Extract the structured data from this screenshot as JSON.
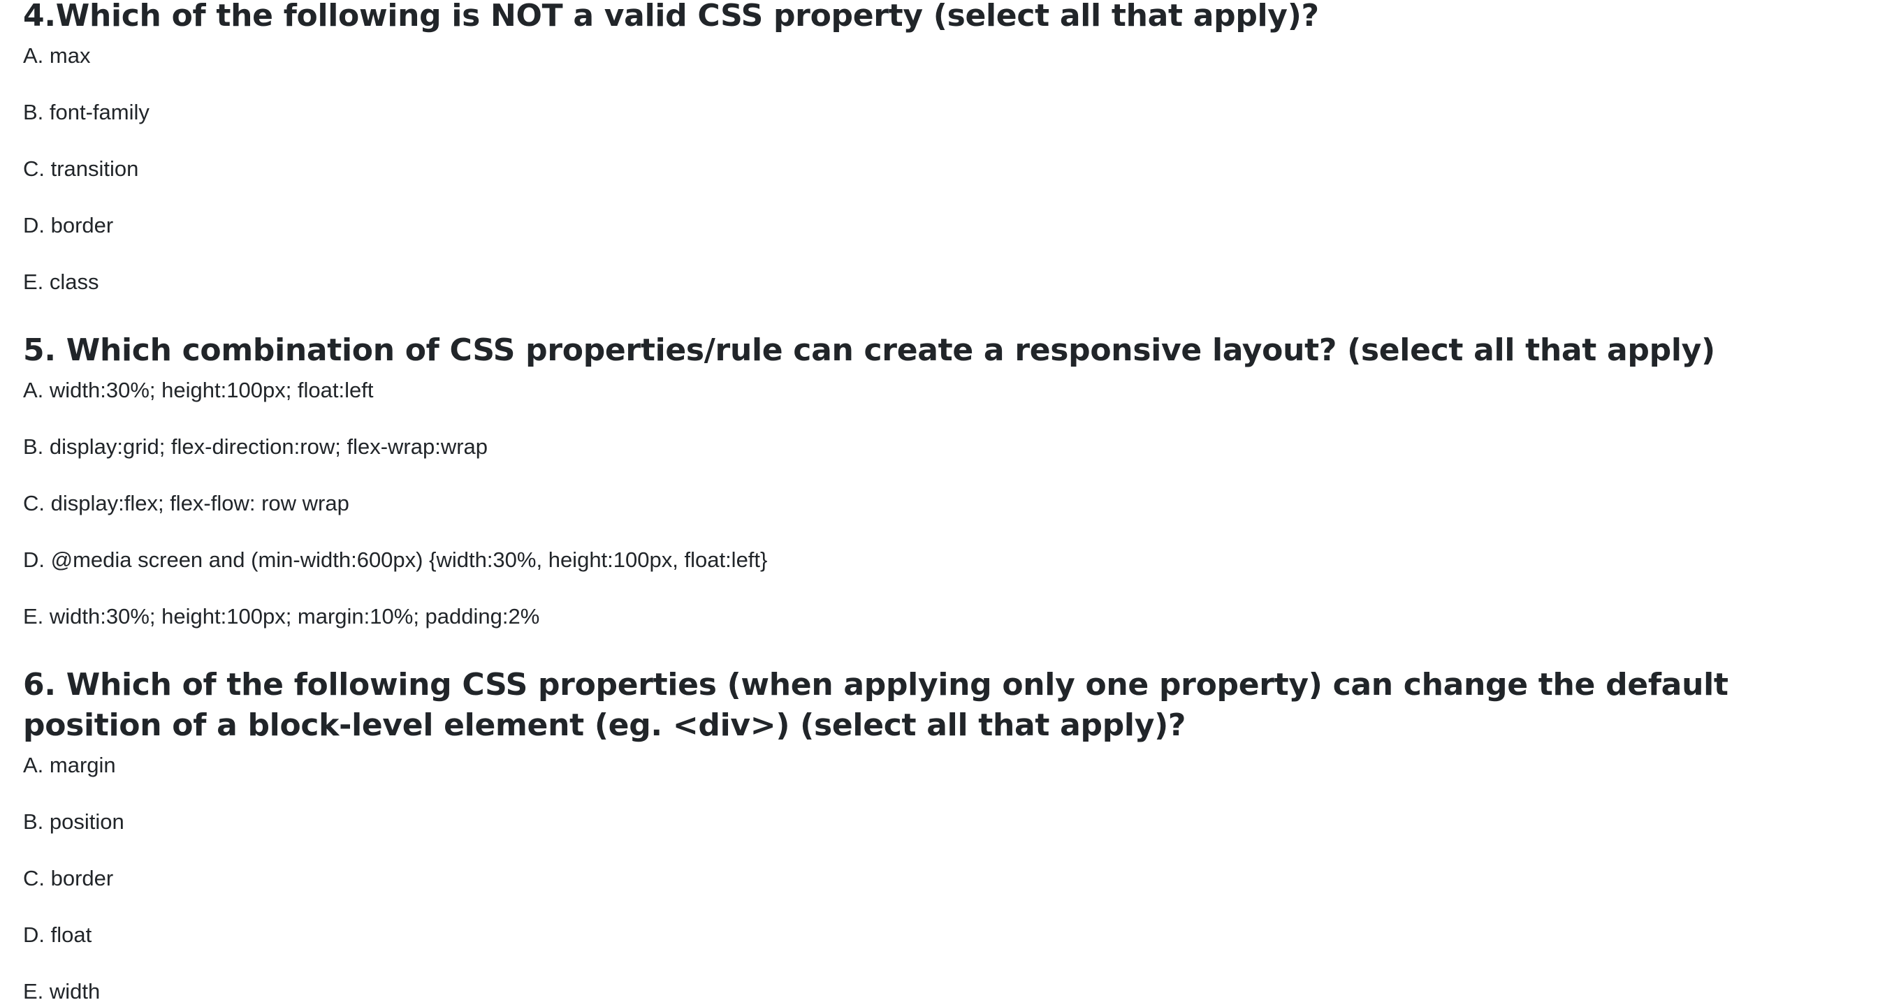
{
  "questions": [
    {
      "title": "4.Which of the following is NOT a valid CSS property (select all that apply)?",
      "options": [
        "A. max",
        "B. font-family",
        "C. transition",
        "D. border",
        "E. class"
      ]
    },
    {
      "title": "5. Which combination of CSS properties/rule can create a responsive layout? (select all that apply)",
      "options": [
        "A. width:30%; height:100px; float:left",
        "B. display:grid; flex-direction:row; flex-wrap:wrap",
        "C. display:flex; flex-flow: row wrap",
        "D. @media screen and (min-width:600px) {width:30%, height:100px, float:left}",
        "E. width:30%; height:100px; margin:10%; padding:2%"
      ]
    },
    {
      "title": "6. Which of the following CSS properties (when applying only one property) can change the default position of a block-level element (eg. <div>) (select all that apply)?",
      "options": [
        "A. margin",
        "B. position",
        "C. border",
        "D. float",
        "E. width"
      ]
    }
  ]
}
